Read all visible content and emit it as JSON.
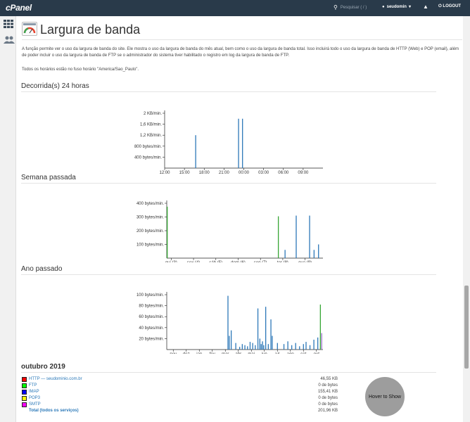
{
  "topbar": {
    "logo": "cPanel",
    "search_placeholder": "Pesquisar ( / )",
    "user": "seudomin",
    "logout": "LOGOUT"
  },
  "page": {
    "title": "Largura de banda",
    "intro": "A função permite ver o uso da largura de banda do site. Ele mostra o uso da largura de banda do mês atual, bem como o uso da largura de banda total. Isso incluirá todo o uso da largura de banda de HTTP (Web) e POP (email), além de poder incluir o uso da largura de banda de FTP se o administrador do sistema tiver habilitado o registro em log da largura de banda de FTP.",
    "timezone_note": "Todos os horários estão no fuso horário \"America/Sao_Paulo\"."
  },
  "legend": [
    {
      "name": "HTTP",
      "color": "#2d78b8"
    },
    {
      "name": "FTP",
      "color": "#f0902e"
    },
    {
      "name": "IMAP",
      "color": "#37a635"
    },
    {
      "name": "POP3",
      "color": "#d23a34"
    },
    {
      "name": "SMTP",
      "color": "#9a6ec9"
    }
  ],
  "chart_data": [
    {
      "type": "bar",
      "title": "Decorrida(s) 24 horas",
      "y_unit": "KB/min.",
      "yticks": [
        "400 bytes/min.",
        "800 bytes/min.",
        "1,2 KB/min.",
        "1,6 KB/min.",
        "2 KB/min."
      ],
      "ytick_values": [
        0.4,
        0.8,
        1.2,
        1.6,
        2.0
      ],
      "ylim": [
        0,
        2.0
      ],
      "xticks": [
        "12:00",
        "15:00",
        "18:00",
        "21:00",
        "00:00",
        "03:00",
        "06:00",
        "09:00"
      ],
      "xtick_hours": [
        0,
        3,
        6,
        9,
        12,
        15,
        18,
        21
      ],
      "xlim_hours": [
        0,
        24
      ],
      "series": [
        {
          "name": "HTTP",
          "hour": [
            4.7,
            11.2,
            11.8
          ],
          "values": [
            1.2,
            1.8,
            1.8
          ]
        }
      ]
    },
    {
      "type": "bar",
      "title": "Semana passada",
      "y_unit": "bytes/min.",
      "yticks": [
        "100 bytes/min.",
        "200 bytes/min.",
        "300 bytes/min.",
        "400 bytes/min."
      ],
      "ytick_values": [
        100,
        200,
        300,
        400
      ],
      "ylim": [
        0,
        400
      ],
      "xticks": [
        "qui (3)",
        "sex (4)",
        "sáb (5)",
        "dom (6)",
        "seg (7)",
        "ter (8)",
        "qua (9)"
      ],
      "xtick_days": [
        0.2,
        1.2,
        2.2,
        3.2,
        4.2,
        5.2,
        6.2
      ],
      "xlim_days": [
        0,
        7
      ],
      "series": [
        {
          "name": "HTTP",
          "day": [
            5.3,
            5.8,
            6.4,
            6.8,
            6.6
          ],
          "values": [
            60,
            310,
            310,
            100,
            60
          ]
        },
        {
          "name": "IMAP",
          "day": [
            0.02,
            5.0
          ],
          "values": [
            375,
            305
          ]
        }
      ]
    },
    {
      "type": "bar",
      "title": "Ano passado",
      "y_unit": "bytes/min.",
      "yticks": [
        "20 bytes/min.",
        "40 bytes/min.",
        "60 bytes/min.",
        "80 bytes/min.",
        "100 bytes/min."
      ],
      "ytick_values": [
        20,
        40,
        60,
        80,
        100
      ],
      "ylim": [
        0,
        100
      ],
      "xticks": [
        "nov",
        "dez",
        "jan",
        "fev",
        "mar",
        "abr",
        "mai",
        "jun",
        "jul",
        "ago",
        "set",
        "out"
      ],
      "xtick_months": [
        0.5,
        1.5,
        2.5,
        3.5,
        4.5,
        5.5,
        6.5,
        7.5,
        8.5,
        9.5,
        10.5,
        11.5
      ],
      "xlim_months": [
        0,
        12
      ],
      "series": [
        {
          "name": "HTTP",
          "month": [
            4.7,
            4.8,
            4.95,
            5.3,
            5.6,
            5.8,
            6.0,
            6.2,
            6.4,
            6.6,
            6.8,
            7.0,
            7.15,
            7.25,
            7.35,
            7.45,
            7.6,
            7.8,
            8.0,
            8.1,
            8.5,
            9.0,
            9.3,
            9.6,
            9.9,
            10.2,
            10.5,
            10.7,
            11.0,
            11.3,
            11.6
          ],
          "values": [
            98,
            25,
            35,
            12,
            5,
            10,
            8,
            6,
            14,
            12,
            8,
            75,
            20,
            10,
            15,
            8,
            78,
            10,
            55,
            25,
            12,
            10,
            15,
            8,
            12,
            6,
            10,
            14,
            8,
            18,
            22
          ]
        },
        {
          "name": "IMAP",
          "month": [
            11.8
          ],
          "values": [
            82
          ]
        },
        {
          "name": "SMTP",
          "month": [
            11.9
          ],
          "values": [
            30
          ]
        }
      ]
    }
  ],
  "month_summary": {
    "title": "outubro 2019",
    "rows": [
      {
        "label": "HTTP — seudominio.com.br",
        "value": "46,55 KB",
        "color": "#ff0000"
      },
      {
        "label": "FTP",
        "value": "0 de bytes",
        "color": "#00ff00"
      },
      {
        "label": "IMAP",
        "value": "155,41 KB",
        "color": "#0000ff"
      },
      {
        "label": "POP3",
        "value": "0 de bytes",
        "color": "#ffff00"
      },
      {
        "label": "SMTP",
        "value": "0 de bytes",
        "color": "#ff00ff"
      }
    ],
    "total_label": "Total (todos os serviços)",
    "total_value": "201,96 KB",
    "hover_button": "Hover to Show"
  }
}
